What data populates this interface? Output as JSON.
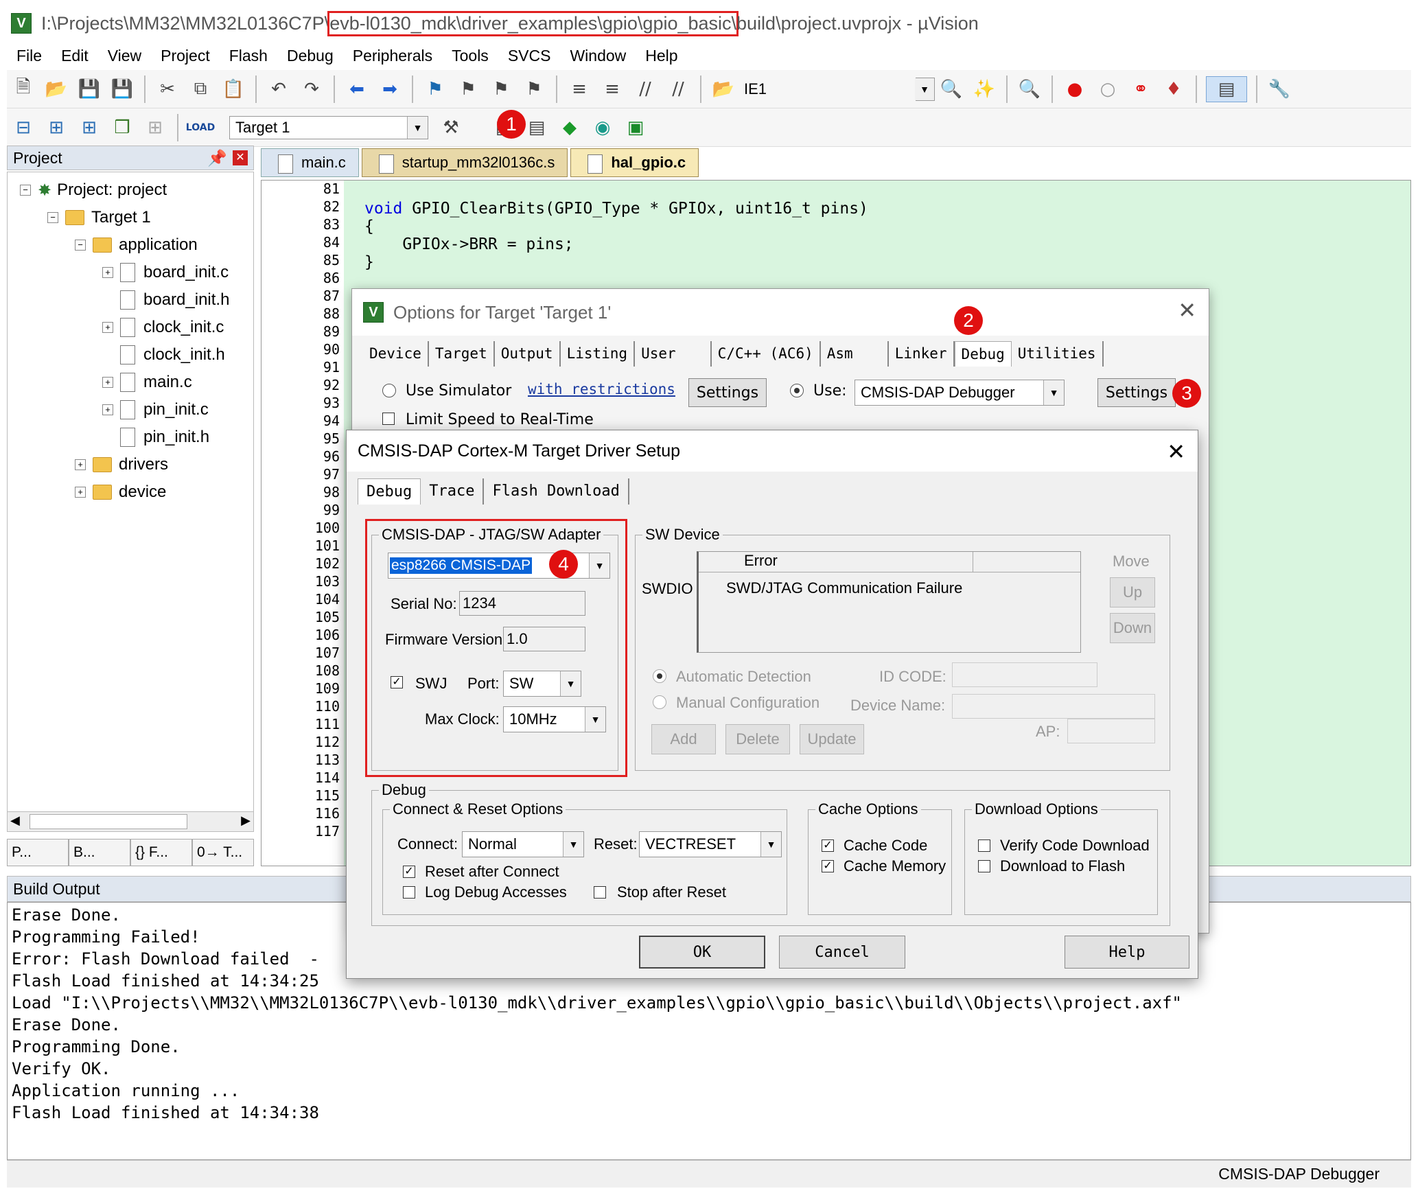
{
  "title": {
    "prefix": "I:\\Projects\\MM32\\MM32L0136C7P\\",
    "highlight": "evb-l0130_mdk\\driver_examples\\gpio\\gpio_basic\\",
    "suffix": "build\\project.uvprojx - µVision"
  },
  "menu": [
    "File",
    "Edit",
    "View",
    "Project",
    "Flash",
    "Debug",
    "Peripherals",
    "Tools",
    "SVCS",
    "Window",
    "Help"
  ],
  "toolbar": {
    "ie1": "IE1",
    "target": "Target 1"
  },
  "project_panel": {
    "title": "Project",
    "root": "Project: project",
    "target": "Target 1",
    "folder_app": "application",
    "files": [
      "board_init.c",
      "board_init.h",
      "clock_init.c",
      "clock_init.h",
      "main.c",
      "pin_init.c",
      "pin_init.h"
    ],
    "folder_drivers": "drivers",
    "folder_device": "device",
    "tabs": [
      "P...",
      "B...",
      "{} F...",
      "0→ T..."
    ]
  },
  "file_tabs": [
    "main.c",
    "startup_mm32l0136c.s",
    "hal_gpio.c"
  ],
  "editor": {
    "line_numbers": [
      "81",
      "82",
      "83",
      "84",
      "85",
      "86",
      "87",
      "88",
      "89",
      "90",
      "91",
      "92",
      "93",
      "94",
      "95",
      "96",
      "97",
      "98",
      "99",
      "100",
      "101",
      "102",
      "103",
      "104",
      "105",
      "106",
      "107",
      "108",
      "109",
      "110",
      "111",
      "112",
      "113",
      "114",
      "115",
      "116",
      "117"
    ],
    "code_kw": "void",
    "code_1": " GPIO_ClearBits(GPIO_Type * GPIOx, uint16_t pins)",
    "code_2": "{",
    "code_3": "    GPIOx->BRR = pins;",
    "code_4": "}"
  },
  "options_dialog": {
    "title": "Options for Target 'Target 1'",
    "tabs": [
      "Device",
      "Target",
      "Output",
      "Listing",
      "User",
      "C/C++ (AC6)",
      "Asm",
      "Linker",
      "Debug",
      "Utilities"
    ],
    "use_simulator": "Use Simulator",
    "restrictions": "with restrictions",
    "settings": "Settings",
    "limit_speed": "Limit Speed to Real-Time",
    "use": "Use:",
    "debugger": "CMSIS-DAP Debugger"
  },
  "driver_dialog": {
    "title": "CMSIS-DAP Cortex-M Target Driver Setup",
    "tabs": [
      "Debug",
      "Trace",
      "Flash Download"
    ],
    "adapter": {
      "group": "CMSIS-DAP - JTAG/SW Adapter",
      "device": "esp8266 CMSIS-DAP",
      "serial_label": "Serial No:",
      "serial": "1234",
      "fw_label": "Firmware Version:",
      "fw": "1.0",
      "swj": "SWJ",
      "port_label": "Port:",
      "port": "SW",
      "clock_label": "Max Clock:",
      "clock": "10MHz"
    },
    "sw_device": {
      "group": "SW Device",
      "col_error": "Error",
      "row_label": "SWDIO",
      "row_error": "SWD/JTAG Communication Failure",
      "move": "Move",
      "up": "Up",
      "down": "Down",
      "auto": "Automatic Detection",
      "manual": "Manual Configuration",
      "id_code": "ID CODE:",
      "device_name": "Device Name:",
      "ap": "AP:",
      "add": "Add",
      "delete": "Delete",
      "update": "Update"
    },
    "debug": {
      "group": "Debug",
      "connect_group": "Connect & Reset Options",
      "connect_label": "Connect:",
      "connect": "Normal",
      "reset_label": "Reset:",
      "reset": "VECTRESET",
      "reset_after": "Reset after Connect",
      "log_debug": "Log Debug Accesses",
      "stop_after": "Stop after Reset",
      "cache_group": "Cache Options",
      "cache_code": "Cache Code",
      "cache_memory": "Cache Memory",
      "download_group": "Download Options",
      "verify": "Verify Code Download",
      "download_flash": "Download to Flash"
    },
    "ok": "OK",
    "cancel": "Cancel",
    "help": "Help"
  },
  "build_output": {
    "title": "Build Output",
    "lines": [
      "Erase Done.",
      "Programming Failed!",
      "Error: Flash Download failed  -",
      "Flash Load finished at 14:34:25",
      "Load \"I:\\\\Projects\\\\MM32\\\\MM32L0136C7P\\\\evb-l0130_mdk\\\\driver_examples\\\\gpio\\\\gpio_basic\\\\build\\\\Objects\\\\project.axf\"",
      "Erase Done.",
      "Programming Done.",
      "Verify OK.",
      "Application running ...",
      "Flash Load finished at 14:34:38"
    ]
  },
  "status": "CMSIS-DAP Debugger",
  "badges": [
    "1",
    "2",
    "3",
    "4"
  ],
  "colors": {
    "accent_red": "#e02020",
    "editor_bg": "#d9f5df"
  }
}
